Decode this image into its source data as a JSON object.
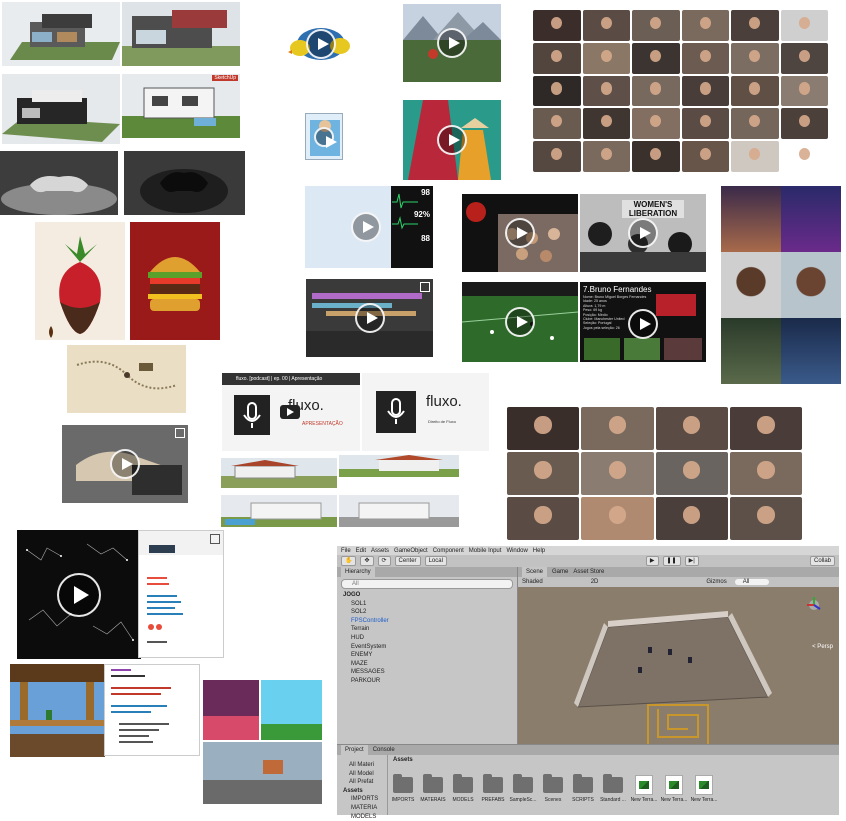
{
  "tiles": {
    "sketchup_badge": "SketchUp",
    "fluxo_video_title": "fluxo. [podcast] | ep. 00 | Apresentação",
    "fluxo_brand": "fluxo.",
    "fluxo_brand_dot": "fluxo.",
    "fluxo_subtitle_1": "APRESENTAÇÃO",
    "fluxo_subtitle_2": "Direito de Fluxo",
    "player_card": {
      "title": "7.Bruno Fernandes",
      "lines": [
        "Nome: Bruno Miguel Borges Fernandes",
        "Idade: 25 anos",
        "Altura: 1,79 m",
        "Peso: 69 kg",
        "Posição: Médio",
        "Clube: Manchester United",
        "Seleção: Portugal",
        "Jogos pela seleção: 26"
      ]
    },
    "protest_sign": "WOMEN'S LIBERATION",
    "vitals": {
      "v1": "98",
      "v2": "92%",
      "v3": "88"
    }
  },
  "unity": {
    "menu": [
      "File",
      "Edit",
      "Assets",
      "GameObject",
      "Component",
      "Mobile Input",
      "Window",
      "Help"
    ],
    "toolbar": {
      "center": "Center",
      "local": "Local",
      "collab": "Collab"
    },
    "hierarchy": {
      "tab": "Hierarchy",
      "search": "All",
      "root": "JOGO",
      "items": [
        "SOL1",
        "SOL2",
        "FPSController",
        "Terrain",
        "HUD",
        "EventSystem",
        "ENEMY",
        "MAZE",
        "MESSAGES",
        "PARKOUR"
      ]
    },
    "scene": {
      "tabs": [
        "Scene",
        "Game",
        "Asset Store"
      ],
      "shading": "Shaded",
      "mode": "2D",
      "gizmos": "Gizmos",
      "search": "All",
      "persp": "< Persp"
    },
    "project": {
      "tabs": [
        "Project",
        "Console"
      ],
      "favorites": [
        "All Materi",
        "All Model",
        "All Prefat"
      ],
      "tree_root": "Assets",
      "tree": [
        "IMPORTS",
        "MATERIA",
        "MODELS"
      ],
      "breadcrumb": "Assets",
      "assets": [
        "IMPORTS",
        "MATERAIS",
        "MODELS",
        "PREFABS",
        "SampleSc...",
        "Scenes",
        "SCRIPTS",
        "Standard ...",
        "New Terra...",
        "New Terra...",
        "New Terra..."
      ]
    }
  },
  "colors": {
    "unity_scene": "#8a7d6c",
    "unity_panel": "#c6c6c6",
    "accent_blue": "#1d5ec9"
  }
}
